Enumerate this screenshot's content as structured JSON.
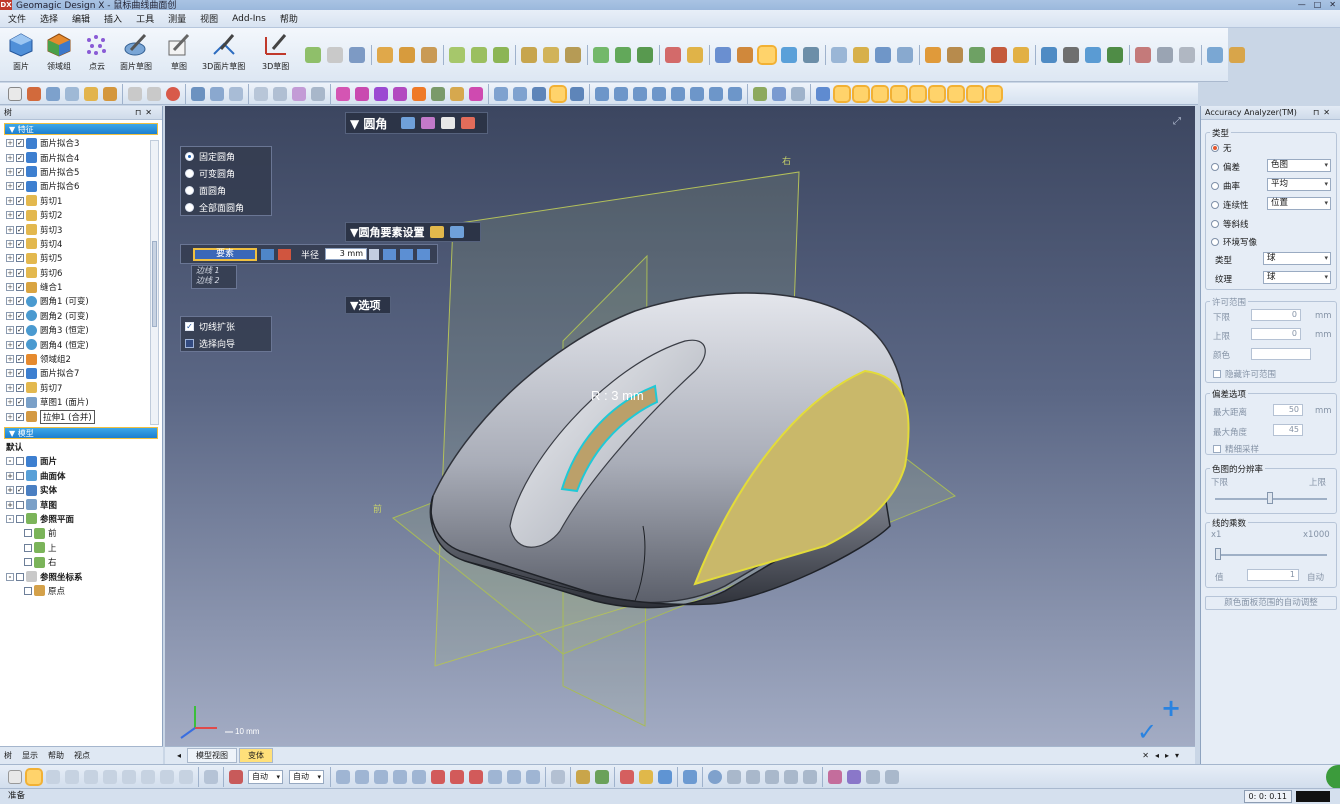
{
  "window": {
    "title": "Geomagic Design X - 鼠标曲线曲面创",
    "controls": [
      "—",
      "□",
      "✕"
    ]
  },
  "menu": [
    "文件",
    "选择",
    "编辑",
    "插入",
    "工具",
    "测量",
    "视图",
    "Add-Ins",
    "帮助"
  ],
  "ribbon": {
    "big_buttons": [
      "面片",
      "领域组",
      "点云",
      "面片草图",
      "草图",
      "3D面片草图",
      "3D草图"
    ]
  },
  "tree_panel": {
    "header": "树",
    "feature_section": "特征",
    "features": [
      "面片拟合3",
      "面片拟合4",
      "面片拟合5",
      "面片拟合6",
      "剪切1",
      "剪切2",
      "剪切3",
      "剪切4",
      "剪切5",
      "剪切6",
      "缝合1",
      "圆角1 (可变)",
      "圆角2 (可变)",
      "圆角3 (恒定)",
      "圆角4 (恒定)",
      "领域组2",
      "面片拟合7",
      "剪切7",
      "草图1 (面片)",
      "拉伸1 (合并)"
    ],
    "model_section": "模型",
    "model_items": [
      "默认",
      "面片",
      "曲面体",
      "实体",
      "草图",
      "参照平面",
      "前",
      "上",
      "右",
      "参照坐标系",
      "原点"
    ],
    "tabs": [
      "树",
      "显示",
      "帮助",
      "视点"
    ]
  },
  "fillet_panel": {
    "title": "圆角",
    "options": [
      "固定圆角",
      "可变圆角",
      "面圆角",
      "全部面圆角"
    ],
    "selected": "固定圆角",
    "settings_title": "圆角要素设置",
    "element_label": "要素",
    "radius_label": "半径",
    "radius_value": "3 mm",
    "edges": [
      "边线 1",
      "边线 2"
    ],
    "opts_title": "选项",
    "checkboxes": [
      {
        "label": "切线扩张",
        "checked": true
      },
      {
        "label": "选择向导",
        "checked": false
      }
    ]
  },
  "viewport": {
    "plane_label_top": "右",
    "plane_label_left": "前",
    "dimension_label": "R : 3 mm",
    "scale_label": "10 mm",
    "tabs": [
      "模型视图",
      "变体"
    ]
  },
  "accuracy_panel": {
    "header": "Accuracy Analyzer(TM)",
    "type_group": "类型",
    "type_options": [
      {
        "label": "无",
        "selected": true
      },
      {
        "label": "偏差",
        "selected": false,
        "value": "色图"
      },
      {
        "label": "曲率",
        "selected": false,
        "value": "平均"
      },
      {
        "label": "连续性",
        "selected": false,
        "value": "位置"
      },
      {
        "label": "等斜线",
        "selected": false
      },
      {
        "label": "环境写像",
        "selected": false
      }
    ],
    "env_type_label": "类型",
    "env_type_value": "球",
    "env_texture_label": "纹理",
    "env_texture_value": "球",
    "tolerance_group": "许可范围",
    "lower_label": "下限",
    "lower_value": "0",
    "upper_label": "上限",
    "upper_value": "0",
    "unit_mm": "mm",
    "color_label": "颜色",
    "hide_tolerance": "隐藏许可范围",
    "deviation_group": "偏差选项",
    "max_distance_label": "最大距离",
    "max_distance_value": "50",
    "max_angle_label": "最大角度",
    "max_angle_value": "45",
    "fine_sampling": "精细采样",
    "resolution_group": "色图的分辨率",
    "res_low": "下限",
    "res_high": "上限",
    "curve_group": "线的乘数",
    "curve_min": "x1",
    "curve_max": "x1000",
    "value_label": "值",
    "value_value": "1",
    "auto_label": "自动",
    "auto_adjust": "颜色面板范围的自动调整"
  },
  "bottom_toolbar": {
    "dropdown1": "自动",
    "dropdown2": "自动"
  },
  "status": {
    "text": "准备",
    "time": "0:  0:  0.11"
  },
  "colors": {
    "accent": "#1d7fcf",
    "highlight": "#ffd36b",
    "fillet_face": "#c9b86a"
  }
}
